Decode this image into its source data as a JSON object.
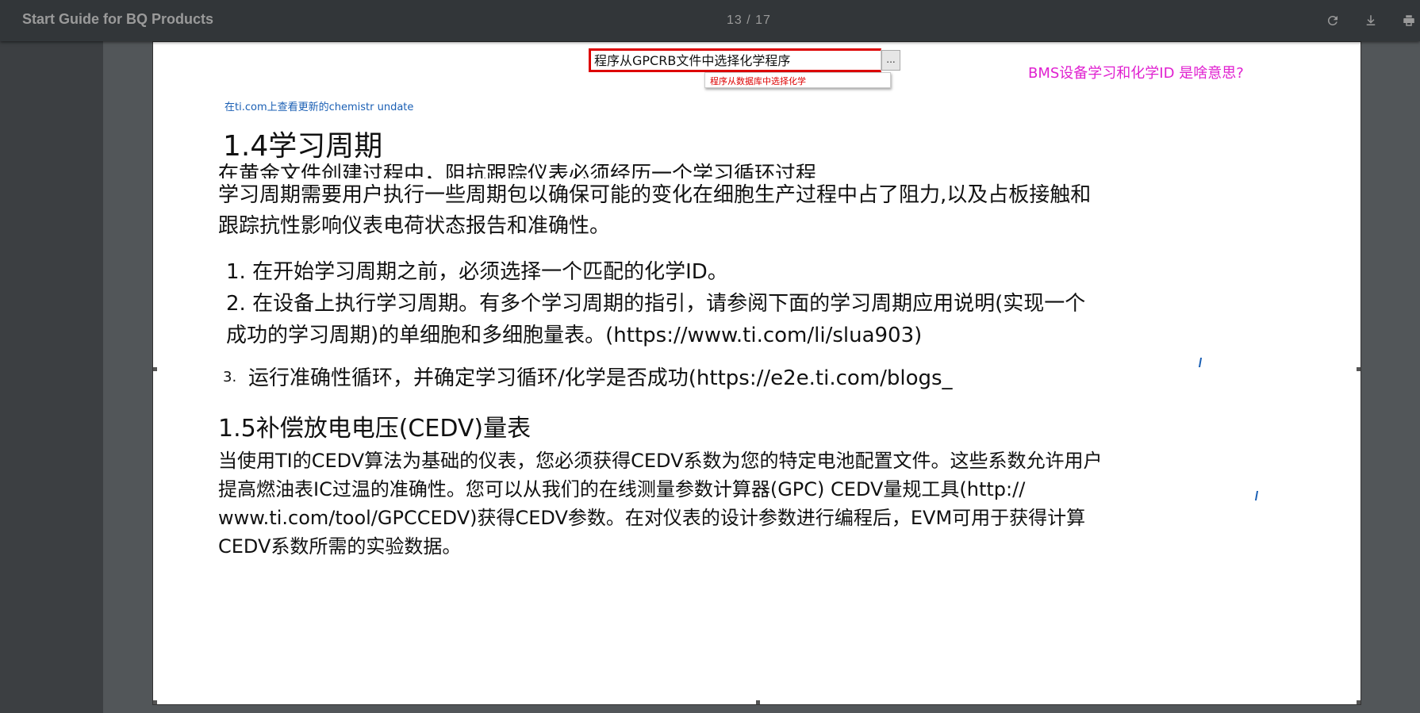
{
  "toolbar": {
    "doc_title": "Start Guide for BQ Products",
    "page_current": "13",
    "page_sep": "/",
    "page_total": "17",
    "icons": [
      "rotate-icon",
      "download-icon",
      "print-icon"
    ]
  },
  "page": {
    "combo": {
      "value": "程序从GPCRB文件中选择化学程序",
      "button_label": "...",
      "dropdown_item": "程序从数据库中选择化学"
    },
    "annotation": "BMS设备学习和化学ID   是啥意思?",
    "top_link": "在ti.com上查看更新的chemistr undate",
    "section_14": {
      "heading": "1.4学习周期",
      "line_clipped": "在黄金文件创建过程中，阻抗跟踪仪表必须经历一个学习循环过程",
      "para_line1": "学习周期需要用户执行一些周期包以确保可能的变化在细胞生产过程中占了阻力,以及占板接触和",
      "para_line2": "跟踪抗性影响仪表电荷状态报告和准确性。",
      "item1": "1. 在开始学习周期之前，必须选择一个匹配的化学ID。",
      "item2_line1": "2. 在设备上执行学习周期。有多个学习周期的指引，请参阅下面的学习周期应用说明(实现一个",
      "item2_line2": "成功的学习周期)的单细胞和多细胞量表。(https://www.ti.com/li/slua903)",
      "item3_num": "3.",
      "item3": "运行准确性循环，并确定学习循环/化学是否成功(https://e2e.ti.com/blogs_"
    },
    "section_15": {
      "heading": "1.5补偿放电电压(CEDV)量表",
      "line1": "当使用TI的CEDV算法为基础的仪表，您必须获得CEDV系数为您的特定电池配置文件。这些系数允许用户",
      "line2": "提高燃油表IC过温的准确性。您可以从我们的在线测量参数计算器(GPC) CEDV量规工具(http://",
      "line3": "www.ti.com/tool/GPCCEDV)获得CEDV参数。在对仪表的设计参数进行编程后，EVM可用于获得计算",
      "line4": "CEDV系数所需的实验数据。"
    }
  },
  "colors": {
    "toolbar_bg": "#323639",
    "viewer_bg": "#525659",
    "annotation": "#e020d0",
    "link": "#1a5fb4",
    "highlight_red": "#d00"
  }
}
